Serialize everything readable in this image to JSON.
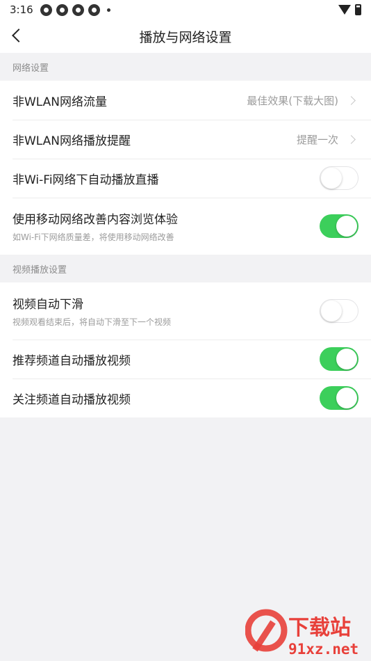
{
  "status_bar": {
    "time": "3:16"
  },
  "header": {
    "title": "播放与网络设置"
  },
  "sections": [
    {
      "title": "网络设置",
      "rows": [
        {
          "label": "非WLAN网络流量",
          "value": "最佳效果(下载大图)",
          "control": "chevron"
        },
        {
          "label": "非WLAN网络播放提醒",
          "value": "提醒一次",
          "control": "chevron"
        },
        {
          "label": "非Wi-Fi网络下自动播放直播",
          "control": "toggle",
          "state": "off"
        },
        {
          "label": "使用移动网络改善内容浏览体验",
          "sub": "如Wi-Fi下网络质量差，将使用移动网络改善",
          "control": "toggle",
          "state": "on"
        }
      ]
    },
    {
      "title": "视频播放设置",
      "rows": [
        {
          "label": "视频自动下滑",
          "sub": "视频观看结束后，将自动下滑至下一个视频",
          "control": "toggle",
          "state": "off"
        },
        {
          "label": "推荐频道自动播放视频",
          "control": "toggle",
          "state": "on"
        },
        {
          "label": "关注频道自动播放视频",
          "control": "toggle",
          "state": "on"
        }
      ]
    }
  ],
  "watermark": {
    "text": "下载站",
    "domain": "91xz.net"
  },
  "colors": {
    "toggle_on": "#3ccf5b",
    "background": "#f2f2f4",
    "watermark_red": "#e8403a"
  }
}
